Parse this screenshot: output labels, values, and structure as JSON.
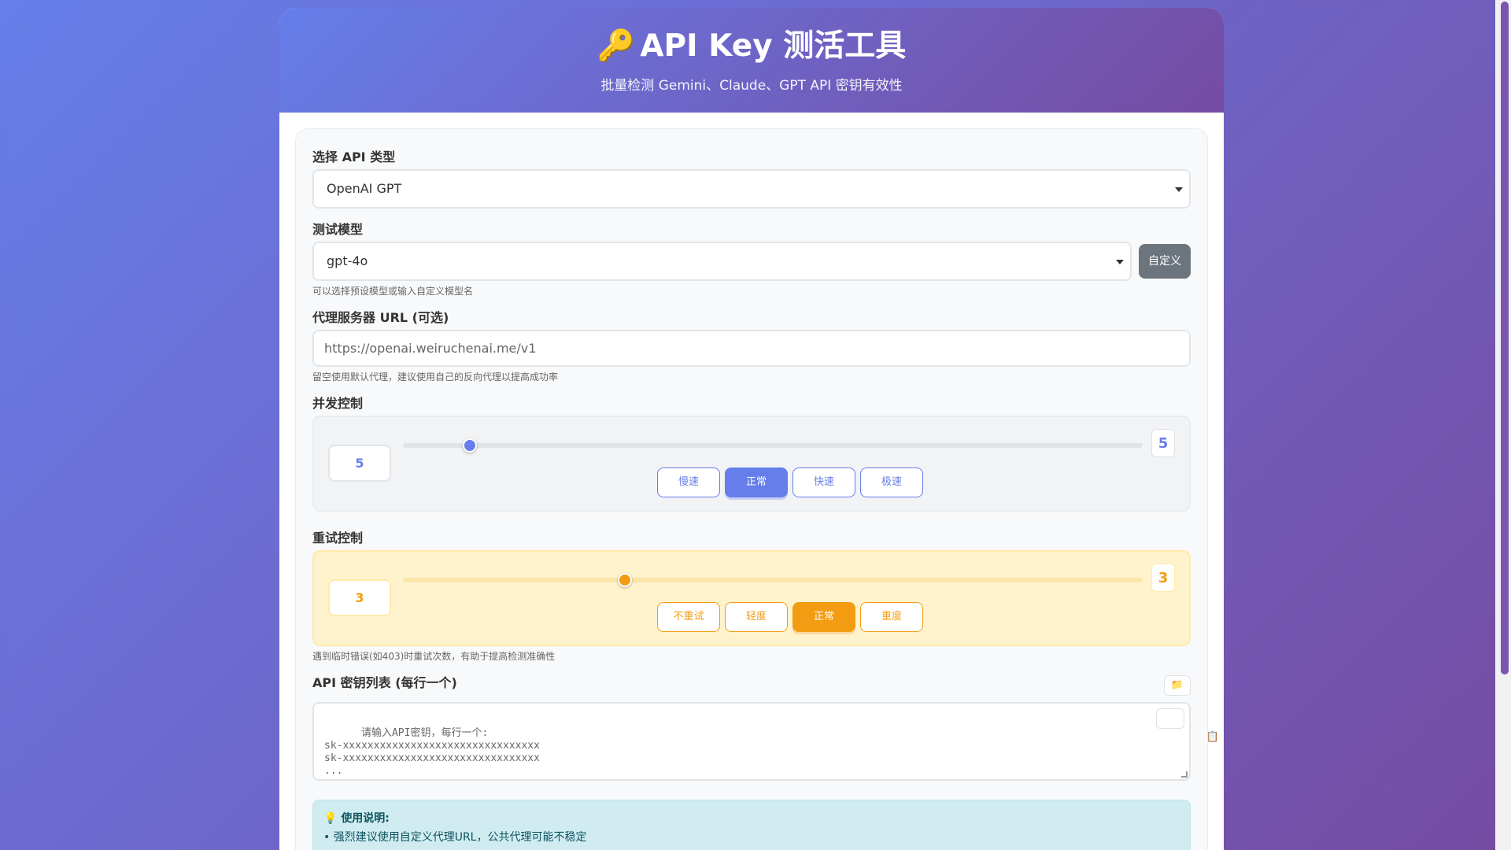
{
  "header": {
    "icon": "🔑",
    "title": "API Key 测活工具",
    "subtitle": "批量检测 Gemini、Claude、GPT API 密钥有效性"
  },
  "api_type": {
    "label": "选择 API 类型",
    "selected": "OpenAI GPT"
  },
  "model": {
    "label": "测试模型",
    "selected": "gpt-4o",
    "custom_button": "自定义",
    "hint": "可以选择预设模型或输入自定义模型名"
  },
  "proxy": {
    "label": "代理服务器 URL (可选)",
    "placeholder": "https://openai.weiruchenai.me/v1",
    "hint": "留空使用默认代理，建议使用自己的反向代理以提高成功率"
  },
  "concurrency": {
    "label": "并发控制",
    "value": "5",
    "slider_fraction": 0.09,
    "presets": [
      "慢速",
      "正常",
      "快速",
      "极速"
    ],
    "active_preset": 1
  },
  "retry": {
    "label": "重试控制",
    "value": "3",
    "slider_fraction": 0.3,
    "presets": [
      "不重试",
      "轻度",
      "正常",
      "重度"
    ],
    "active_preset": 2,
    "hint": "遇到临时错误(如403)时重试次数，有助于提高检测准确性"
  },
  "keys": {
    "label": "API 密钥列表 (每行一个)",
    "folder_icon": "📁",
    "paste_icon": "📋",
    "placeholder": "请输入API密钥，每行一个:\nsk-xxxxxxxxxxxxxxxxxxxxxxxxxxxxxxxx\nsk-xxxxxxxxxxxxxxxxxxxxxxxxxxxxxxxx\n..."
  },
  "notice": {
    "icon": "💡",
    "title": "使用说明:",
    "line1": "• 强烈建议使用自定义代理URL，公共代理可能不稳定"
  }
}
